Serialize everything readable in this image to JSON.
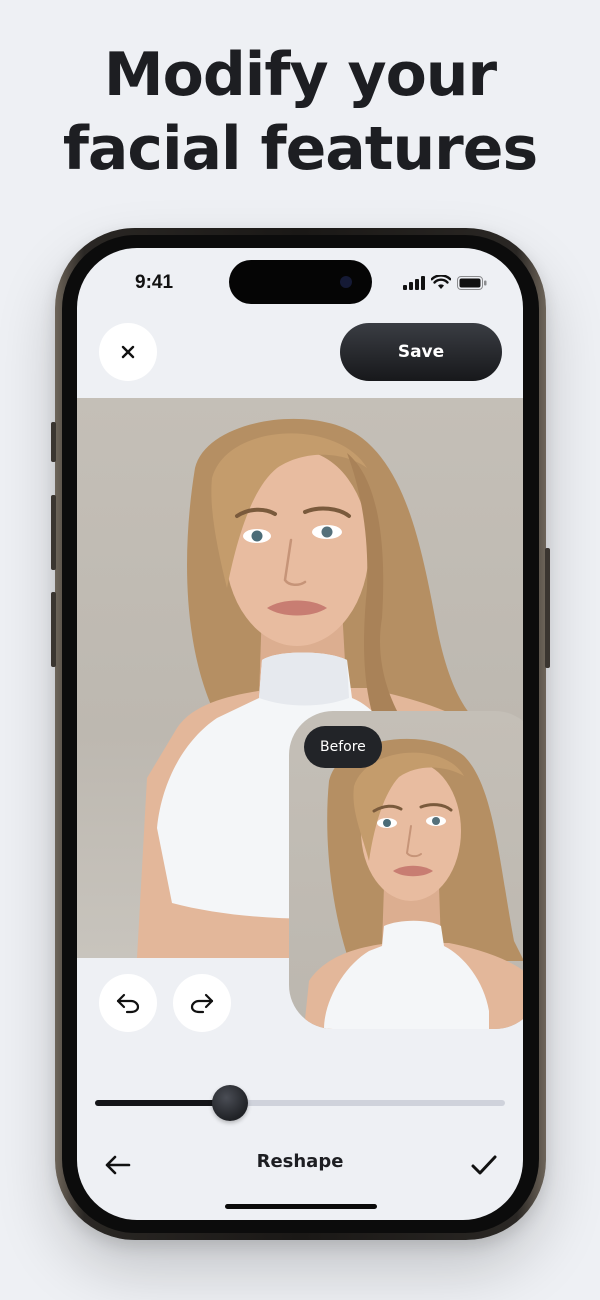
{
  "headline": {
    "line1": "Modify your",
    "line2": "facial features"
  },
  "status_bar": {
    "time": "9:41"
  },
  "toolbar": {
    "close_icon": "close-icon",
    "save_label": "Save"
  },
  "before_card": {
    "badge_label": "Before"
  },
  "history": {
    "undo_icon": "undo-icon",
    "redo_icon": "redo-icon"
  },
  "slider": {
    "value_percent": 33
  },
  "bottom_bar": {
    "back_icon": "arrow-left-icon",
    "title": "Reshape",
    "confirm_icon": "checkmark-icon"
  },
  "colors": {
    "background": "#eef0f4",
    "dark_button": "#1d1e22",
    "accent_fill": "#141518",
    "track": "#cfd2db"
  }
}
